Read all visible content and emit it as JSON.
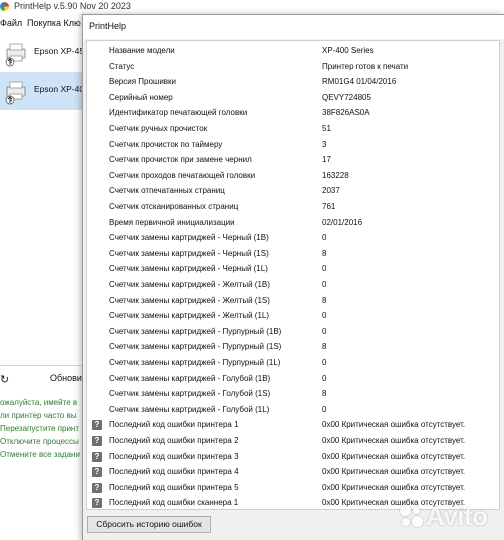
{
  "main_window": {
    "title": "PrintHelp v.5.90 Nov 20 2023",
    "menu": [
      "Файл",
      "Покупка Клю"
    ],
    "printers": [
      {
        "name": "Epson XP-45"
      },
      {
        "name": "Epson XP-40"
      }
    ],
    "refresh_label": "Обнови",
    "hints": [
      "ожалуйста, имейте в",
      "ли принтер часто вы",
      "Перезапустите принт",
      "Отключите процессы",
      "Отмените все задани"
    ]
  },
  "dialog": {
    "title": "PrintHelp",
    "rows": [
      {
        "label": "Название модели",
        "value": "XP-400 Series",
        "error_icon": false
      },
      {
        "label": "Статус",
        "value": "Принтер готов к печати",
        "error_icon": false
      },
      {
        "label": "Версия Прошивки",
        "value": "RM01G4 01/04/2016",
        "error_icon": false
      },
      {
        "label": "Серийный номер",
        "value": "QEVY724805",
        "error_icon": false
      },
      {
        "label": "Идентификатор печатающей головки",
        "value": "38F826AS0A",
        "error_icon": false
      },
      {
        "label": "Счетчик ручных прочисток",
        "value": "51",
        "error_icon": false
      },
      {
        "label": "Счетчик прочисток по таймеру",
        "value": "3",
        "error_icon": false
      },
      {
        "label": "Счетчик прочисток при замене чернил",
        "value": "17",
        "error_icon": false
      },
      {
        "label": "Счетчик проходов печатающей головки",
        "value": "163228",
        "error_icon": false
      },
      {
        "label": "Счетчик отпечатанных страниц",
        "value": "2037",
        "error_icon": false
      },
      {
        "label": "Счетчик отсканированных страниц",
        "value": "761",
        "error_icon": false
      },
      {
        "label": "Время первичной инициализации",
        "value": "02/01/2016",
        "error_icon": false
      },
      {
        "label": "Счетчик замены картриджей - Черный (1B)",
        "value": "0",
        "error_icon": false
      },
      {
        "label": "Счетчик замены картриджей - Черный (1S)",
        "value": "8",
        "error_icon": false
      },
      {
        "label": "Счетчик замены картриджей - Черный (1L)",
        "value": "0",
        "error_icon": false
      },
      {
        "label": "Счетчик замены картриджей - Желтый (1B)",
        "value": "0",
        "error_icon": false
      },
      {
        "label": "Счетчик замены картриджей - Желтый (1S)",
        "value": "8",
        "error_icon": false
      },
      {
        "label": "Счетчик замены картриджей - Желтый (1L)",
        "value": "0",
        "error_icon": false
      },
      {
        "label": "Счетчик замены картриджей - Пурпурный (1B)",
        "value": "0",
        "error_icon": false
      },
      {
        "label": "Счетчик замены картриджей - Пурпурный (1S)",
        "value": "8",
        "error_icon": false
      },
      {
        "label": "Счетчик замены картриджей - Пурпурный (1L)",
        "value": "0",
        "error_icon": false
      },
      {
        "label": "Счетчик замены картриджей - Голубой (1B)",
        "value": "0",
        "error_icon": false
      },
      {
        "label": "Счетчик замены картриджей - Голубой (1S)",
        "value": "8",
        "error_icon": false
      },
      {
        "label": "Счетчик замены картриджей - Голубой (1L)",
        "value": "0",
        "error_icon": false
      },
      {
        "label": "Последний код ошибки принтера 1",
        "value": "0x00 Критическая ошибка отсутствует.",
        "error_icon": true
      },
      {
        "label": "Последний код ошибки принтера 2",
        "value": "0x00 Критическая ошибка отсутствует.",
        "error_icon": true
      },
      {
        "label": "Последний код ошибки принтера 3",
        "value": "0x00 Критическая ошибка отсутствует.",
        "error_icon": true
      },
      {
        "label": "Последний код ошибки принтера 4",
        "value": "0x00 Критическая ошибка отсутствует.",
        "error_icon": true
      },
      {
        "label": "Последний код ошибки принтера 5",
        "value": "0x00 Критическая ошибка отсутствует.",
        "error_icon": true
      },
      {
        "label": "Последний код ошибки сканнера 1",
        "value": "0x00 Критическая ошибка отсутствует.",
        "error_icon": true
      }
    ],
    "error_icon_glyph": "?",
    "reset_button_label": "Сбросить историю ошибок"
  },
  "watermark": {
    "text": "Avito"
  },
  "colors": {
    "selected_printer_bg": "#cfe3f6",
    "hint_text": "#2e7d32",
    "dialog_bg": "#f0f0f0"
  },
  "icons": {
    "printer": "printer-usb-icon",
    "refresh": "refresh-icon",
    "error": "help-question-icon",
    "app": "printhelp-app-icon"
  }
}
